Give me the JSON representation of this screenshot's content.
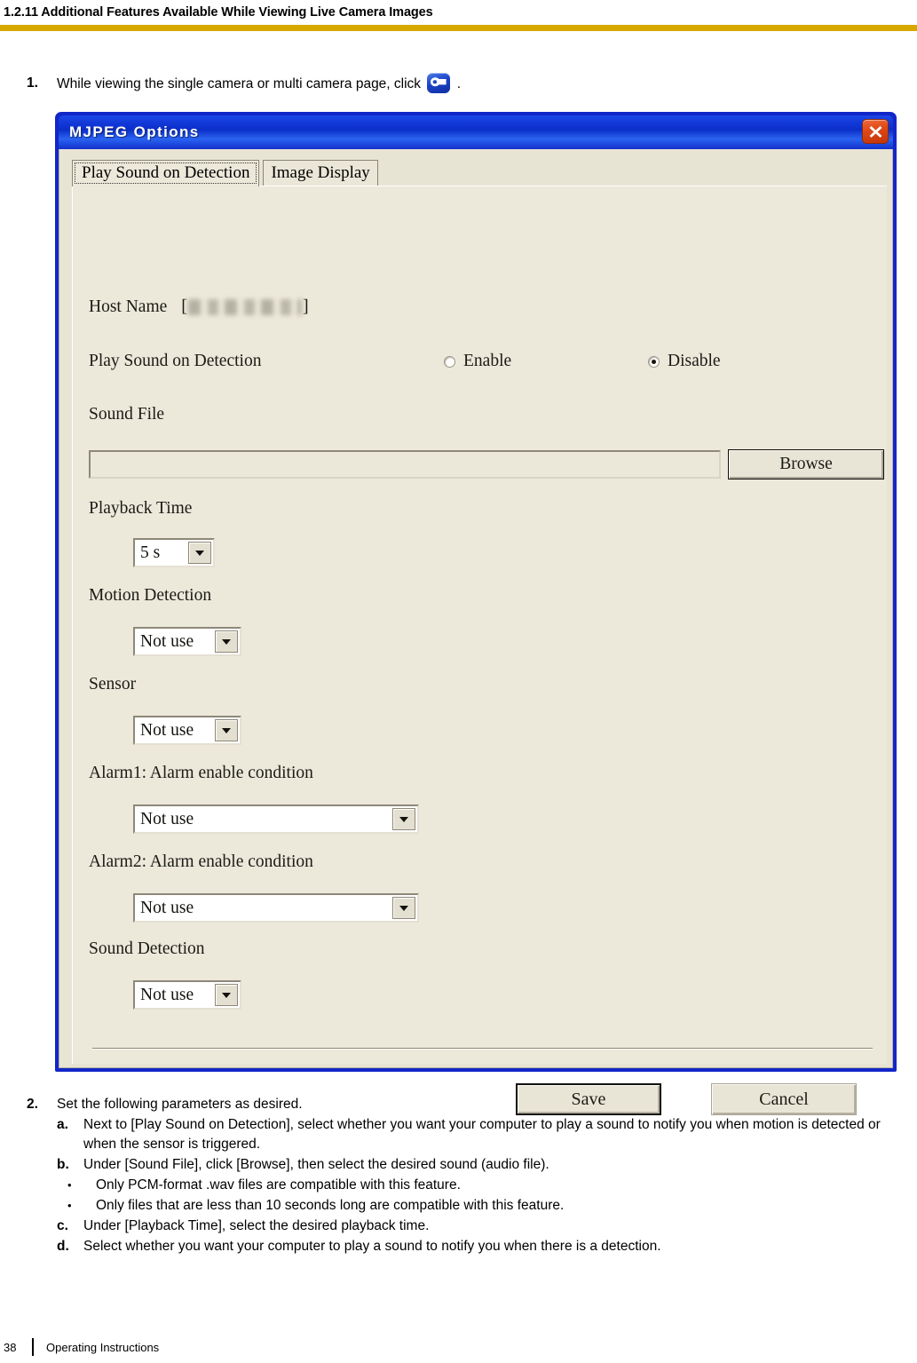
{
  "page_header": {
    "section_title": "1.2.11 Additional Features Available While Viewing Live Camera Images",
    "rule_color": "#d6a800"
  },
  "step1": {
    "number": "1.",
    "text_before": "While viewing the single camera or multi camera page, click",
    "icon": "wrench-icon",
    "text_after": "."
  },
  "dialog": {
    "title": "MJPEG Options",
    "title_bar_color": "#0b2ec9",
    "close_button_label": "close-icon",
    "tabs": [
      {
        "label": "Play Sound on Detection",
        "active": true
      },
      {
        "label": "Image Display",
        "active": false
      }
    ],
    "fields": {
      "host_name": {
        "label": "Host Name",
        "bracket_open": "[",
        "bracket_close": "]",
        "value": ""
      },
      "play_sound_on_detection": {
        "label": "Play Sound on Detection",
        "options": [
          {
            "label": "Enable",
            "selected": false
          },
          {
            "label": "Disable",
            "selected": true
          }
        ]
      },
      "sound_file": {
        "label": "Sound File",
        "value": "",
        "browse_label": "Browse"
      },
      "playback_time": {
        "label": "Playback Time",
        "value": "5 s"
      },
      "motion_detection": {
        "label": "Motion Detection",
        "value": "Not use"
      },
      "sensor": {
        "label": "Sensor",
        "value": "Not use"
      },
      "alarm1": {
        "label": "Alarm1: Alarm enable condition",
        "value": "Not use"
      },
      "alarm2": {
        "label": "Alarm2: Alarm enable condition",
        "value": "Not use"
      },
      "sound_detection": {
        "label": "Sound Detection",
        "value": "Not use"
      }
    },
    "buttons": {
      "save": "Save",
      "cancel": "Cancel"
    }
  },
  "step2": {
    "number": "2.",
    "text": "Set the following parameters as desired.",
    "items": [
      {
        "marker": "a.",
        "text": "Next to [Play Sound on Detection], select whether you want your computer to play a sound to notify you when motion is detected or when the sensor is triggered."
      },
      {
        "marker": "b.",
        "text": "Under [Sound File], click [Browse], then select the desired sound (audio file).",
        "bullets": [
          "Only PCM-format .wav files are compatible with this feature.",
          "Only files that are less than 10 seconds long are compatible with this feature."
        ]
      },
      {
        "marker": "c.",
        "text": "Under [Playback Time], select the desired playback time."
      },
      {
        "marker": "d.",
        "text": "Select whether you want your computer to play a sound to notify you when there is a detection."
      }
    ]
  },
  "page_footer": {
    "page_number": "38",
    "document_title": "Operating Instructions"
  }
}
